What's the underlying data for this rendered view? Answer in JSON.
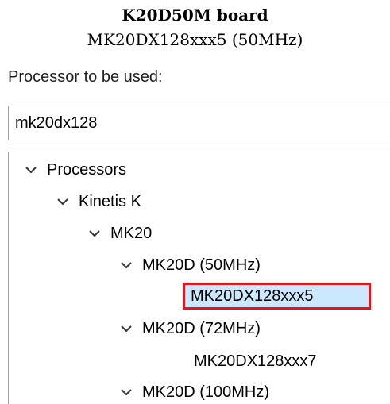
{
  "caption": {
    "title": "K20D50M board",
    "subtitle": "MK20DX128xxx5 (50MHz)"
  },
  "processor_label": "Processor to be used:",
  "search": {
    "value": "mk20dx128"
  },
  "tree": {
    "expander_icon": "chevron-down-icon",
    "root": "Processors",
    "family": "Kinetis K",
    "subfamily": "MK20",
    "group_50": "MK20D (50MHz)",
    "part_50": "MK20DX128xxx5",
    "group_72": "MK20D (72MHz)",
    "part_72": "MK20DX128xxx7",
    "group_100": "MK20D (100MHz)",
    "selected_item": "MK20DX128xxx5",
    "highlight_color": "#e0161c",
    "selection_color": "#cce8ff"
  }
}
